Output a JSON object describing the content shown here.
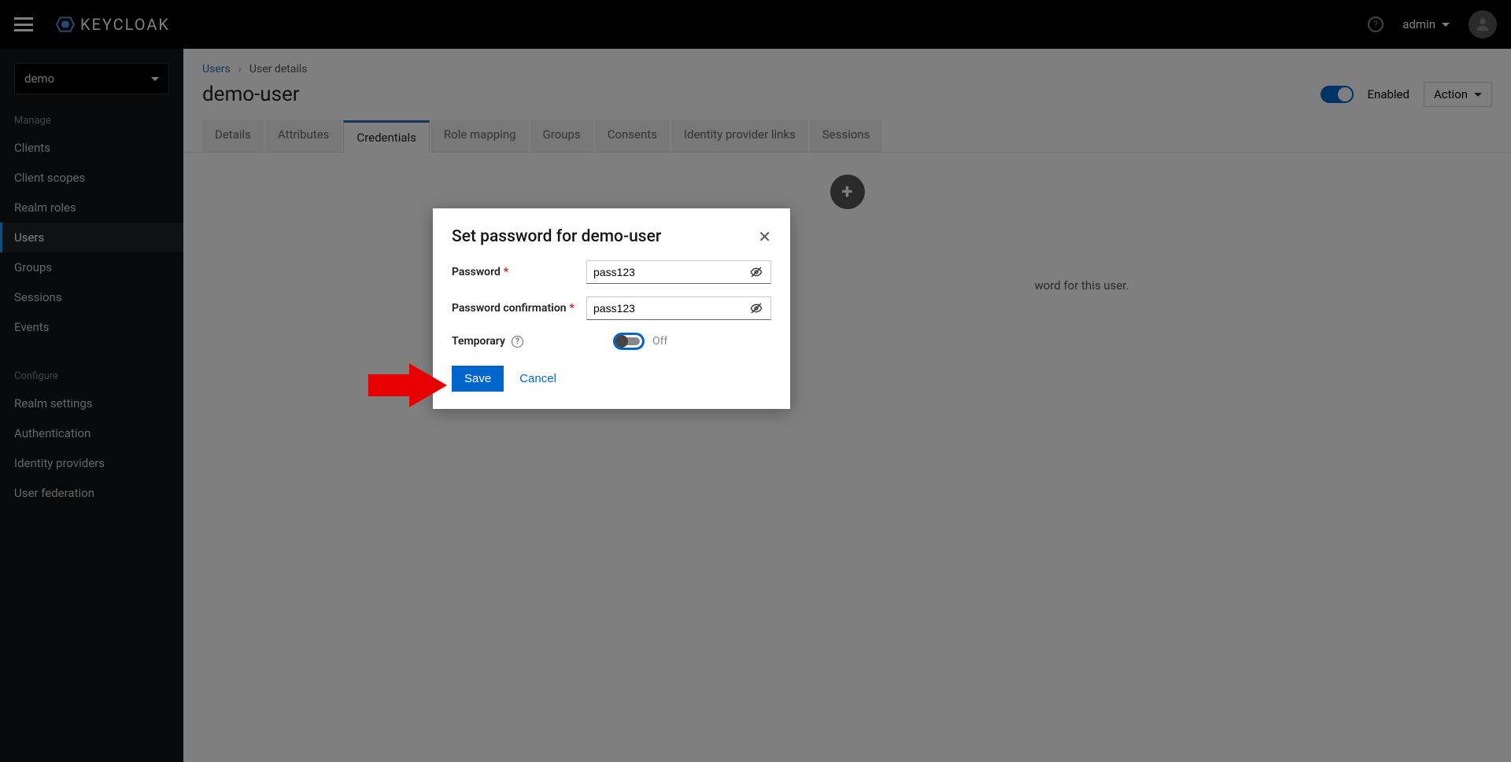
{
  "header": {
    "brand": "KEYCLOAK",
    "username": "admin"
  },
  "sidebar": {
    "realm": "demo",
    "sections": {
      "manage": "Manage",
      "configure": "Configure"
    },
    "manage_items": [
      "Clients",
      "Client scopes",
      "Realm roles",
      "Users",
      "Groups",
      "Sessions",
      "Events"
    ],
    "active_item": "Users",
    "configure_items": [
      "Realm settings",
      "Authentication",
      "Identity providers",
      "User federation"
    ]
  },
  "breadcrumb": {
    "parent": "Users",
    "current": "User details"
  },
  "page": {
    "title": "demo-user",
    "enabled_label": "Enabled",
    "action_label": "Action"
  },
  "tabs": [
    "Details",
    "Attributes",
    "Credentials",
    "Role mapping",
    "Groups",
    "Consents",
    "Identity provider links",
    "Sessions"
  ],
  "active_tab": "Credentials",
  "empty_state": {
    "line2_suffix": "word for this user."
  },
  "modal": {
    "title": "Set password for demo-user",
    "password_label": "Password",
    "password_value": "pass123",
    "confirm_label": "Password confirmation",
    "confirm_value": "pass123",
    "temporary_label": "Temporary",
    "temporary_state": "Off",
    "save": "Save",
    "cancel": "Cancel"
  }
}
